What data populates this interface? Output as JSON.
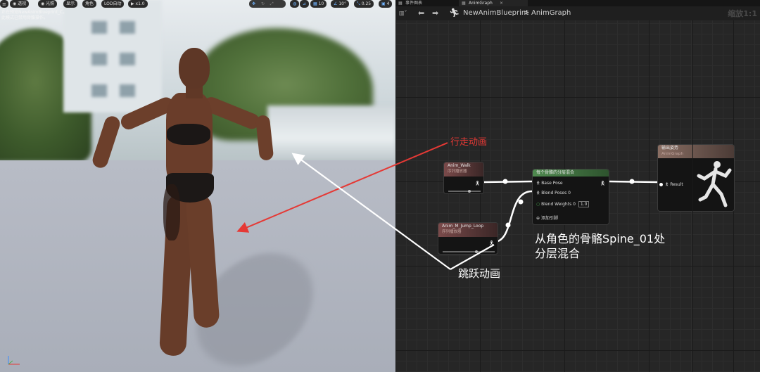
{
  "viewport": {
    "toolbar": {
      "left_buttons": [
        "透视",
        "光照",
        "显示",
        "角色",
        "LOD自动"
      ],
      "play_speed": "x1.0",
      "grid_snap": "10",
      "angle_snap": "10°",
      "scale_snap": "0.25",
      "camera_speed": "4"
    },
    "info_line1": "正在预览NewAnimBlueprint_C。",
    "info_line2": "此模式已禁用骨骼操作。"
  },
  "graph": {
    "tabs": [
      "事件图表",
      "AnimGraph"
    ],
    "breadcrumb": {
      "root": "NewAnimBlueprint",
      "separator": ">",
      "current": "AnimGraph"
    },
    "zoom": "缩放1:1",
    "nodes": {
      "walk": {
        "title": "Anim_Walk",
        "subtitle": "序列播放器"
      },
      "jump": {
        "title": "Anim_M_Jump_Loop",
        "subtitle": "序列播放器"
      },
      "blend": {
        "title": "每个骨骼的分层混合",
        "base_pose": "Base Pose",
        "blend_poses": "Blend Poses 0",
        "blend_weights": "Blend Weights 0",
        "blend_weight_value": "1.0",
        "add_pin": "添加引脚"
      },
      "output": {
        "title": "输出姿势",
        "subtitle": "AnimGraph",
        "result": "Result"
      }
    }
  },
  "annotations": {
    "walk_anim": "行走动画",
    "jump_anim": "跳跃动画",
    "blend_note_line1": "从角色的骨骼Spine_01处",
    "blend_note_line2": "分层混合"
  },
  "colors": {
    "annotation_red": "#e53935",
    "annotation_white": "#ffffff",
    "blend_header": "#4f8a4f"
  }
}
